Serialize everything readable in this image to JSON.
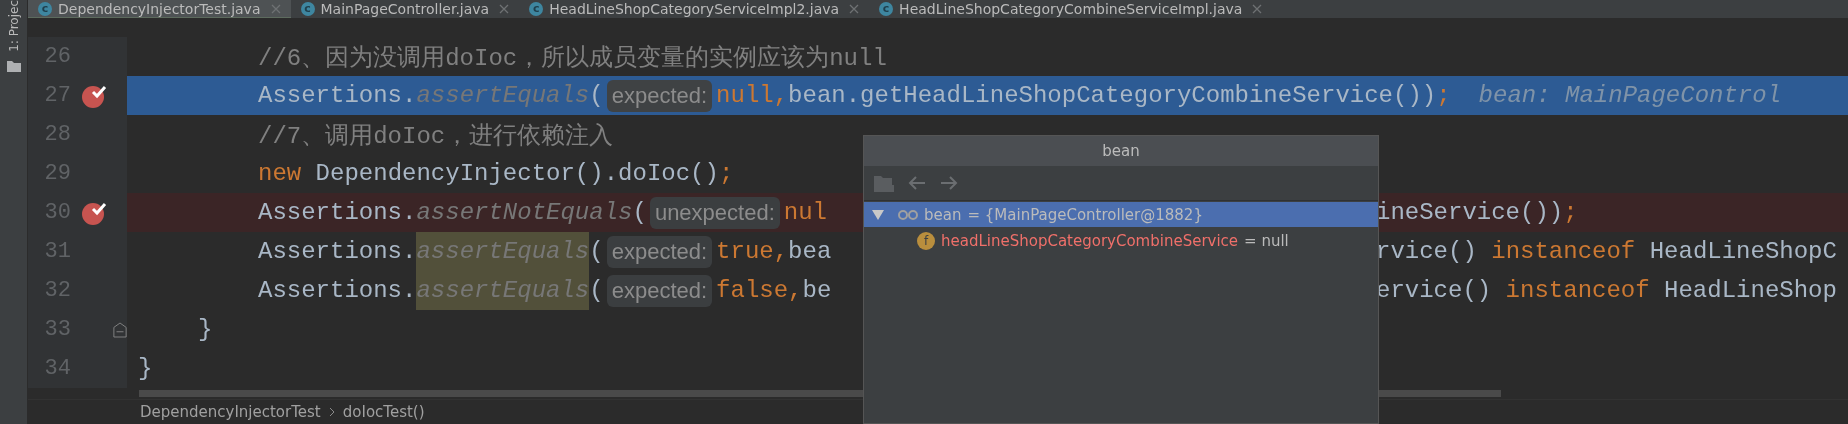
{
  "tool_strip": {
    "label": "1: Projec"
  },
  "tabs": [
    {
      "label": "DependencyInjectorTest.java",
      "icon": "c",
      "selected": true
    },
    {
      "label": "MainPageController.java",
      "icon": "c",
      "selected": false
    },
    {
      "label": "HeadLineShopCategoryServiceImpl2.java",
      "icon": "c",
      "selected": false
    },
    {
      "label": "HeadLineShopCategoryCombineServiceImpl.java",
      "icon": "c",
      "selected": false
    }
  ],
  "code": {
    "lines": [
      {
        "children": [
          {
            "children": [
              {
                "number": "26",
                "breakpoint": false,
                "fold": false,
                "current": false,
                "failed": false,
                "tokens": [
                  {
                    "kind": "comment",
                    "text": "//6、因为没调用doIoc，所以成员变量的实例应该为null"
                  }
                ]
              },
              {
                "number": "27",
                "breakpoint": true,
                "fold": false,
                "current": true,
                "failed": false,
                "tokens": [
                  {
                    "kind": "text",
                    "text": "Assertions."
                  },
                  {
                    "kind": "static",
                    "text": "assertEquals"
                  },
                  {
                    "kind": "text",
                    "text": "("
                  },
                  {
                    "kind": "hint",
                    "text": "expected:"
                  },
                  {
                    "kind": "keyword",
                    "text": "null,"
                  },
                  {
                    "kind": "text",
                    "text": "bean.getHeadLineShopCategoryCombineService())"
                  },
                  {
                    "kind": "keyword",
                    "text": ";"
                  },
                  {
                    "kind": "inline-value",
                    "text": "bean: MainPageControl"
                  }
                ]
              },
              {
                "number": "28",
                "breakpoint": false,
                "fold": false,
                "current": false,
                "failed": false,
                "tokens": [
                  {
                    "kind": "comment",
                    "text": "//7、调用doIoc，进行依赖注入"
                  }
                ]
              },
              {
                "number": "29",
                "breakpoint": false,
                "fold": false,
                "current": false,
                "failed": false,
                "tokens": [
                  {
                    "kind": "keyword",
                    "text": "new"
                  },
                  {
                    "kind": "text",
                    "text": " DependencyInjector().doIoc()"
                  },
                  {
                    "kind": "keyword",
                    "text": ";"
                  }
                ]
              },
              {
                "number": "30",
                "breakpoint": true,
                "fold": false,
                "current": false,
                "failed": true,
                "tokens": [
                  {
                    "kind": "text",
                    "text": "Assertions."
                  },
                  {
                    "kind": "static",
                    "text": "assertNotEquals"
                  },
                  {
                    "kind": "text",
                    "text": "("
                  },
                  {
                    "kind": "hint",
                    "text": "unexpected:"
                  },
                  {
                    "kind": "keyword",
                    "text": "nul"
                  }
                ],
                "right_tokens": [
                  {
                    "kind": "text",
                    "text": "ineService())"
                  },
                  {
                    "kind": "keyword",
                    "text": ";"
                  }
                ]
              },
              {
                "number": "31",
                "breakpoint": false,
                "fold": false,
                "current": false,
                "failed": false,
                "tokens": [
                  {
                    "kind": "text",
                    "text": "Assertions."
                  },
                  {
                    "kind": "static-hl",
                    "text": "assertEquals"
                  },
                  {
                    "kind": "text",
                    "text": "("
                  },
                  {
                    "kind": "hint",
                    "text": "expected:"
                  },
                  {
                    "kind": "keyword",
                    "text": "true,"
                  },
                  {
                    "kind": "text",
                    "text": "bea"
                  }
                ],
                "right_tokens": [
                  {
                    "kind": "text",
                    "text": "rvice()"
                  },
                  {
                    "kind": "keyword",
                    "text": " instanceof"
                  },
                  {
                    "kind": "text",
                    "text": " HeadLineShopC"
                  }
                ]
              },
              {
                "number": "32",
                "breakpoint": false,
                "fold": false,
                "current": false,
                "failed": false,
                "tokens": [
                  {
                    "kind": "text",
                    "text": "Assertions."
                  },
                  {
                    "kind": "static-hl",
                    "text": "assertEquals"
                  },
                  {
                    "kind": "text",
                    "text": "("
                  },
                  {
                    "kind": "hint",
                    "text": "expected:"
                  },
                  {
                    "kind": "keyword",
                    "text": "false,"
                  },
                  {
                    "kind": "text",
                    "text": "be"
                  }
                ],
                "right_tokens": [
                  {
                    "kind": "text",
                    "text": "ervice()"
                  },
                  {
                    "kind": "keyword",
                    "text": " instanceof"
                  },
                  {
                    "kind": "text",
                    "text": " HeadLineShop"
                  }
                ]
              }
            ]
          },
          {
            "number": "33",
            "breakpoint": false,
            "fold": true,
            "current": false,
            "failed": false,
            "tokens": [
              {
                "kind": "text",
                "text": "}"
              }
            ]
          }
        ]
      },
      {
        "number": "34",
        "breakpoint": false,
        "fold": false,
        "current": false,
        "failed": false,
        "tokens": [
          {
            "kind": "text",
            "text": "}"
          }
        ]
      }
    ]
  },
  "popup": {
    "title": "bean",
    "rows": [
      {
        "name": "bean",
        "value": "= {MainPageController@1882}",
        "kind": "watch",
        "expanded": true,
        "selected": true,
        "children": [
          {
            "name": "headLineShopCategoryCombineService",
            "value": "= null",
            "kind": "field",
            "badge": "f",
            "selected": false
          }
        ]
      }
    ]
  },
  "breadcrumbs": [
    "DependencyInjectorTest",
    "doIocTest()"
  ]
}
